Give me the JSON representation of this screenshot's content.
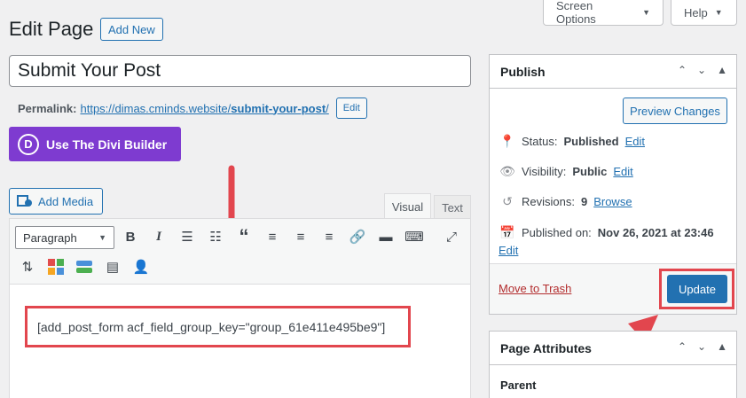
{
  "header": {
    "screen_options": "Screen Options",
    "help": "Help",
    "title": "Edit Page",
    "add_new": "Add New"
  },
  "post": {
    "title_value": "Submit Your Post",
    "permalink_label": "Permalink:",
    "permalink_base": "https://dimas.cminds.website/",
    "permalink_slug": "submit-your-post",
    "permalink_end": "/",
    "permalink_edit": "Edit"
  },
  "divi": {
    "label": "Use The Divi Builder",
    "logo_letter": "D"
  },
  "editor": {
    "add_media": "Add Media",
    "tab_visual": "Visual",
    "tab_text": "Text",
    "format_select": "Paragraph",
    "content": "[add_post_form acf_field_group_key=\"group_61e411e495be9\"]"
  },
  "publish": {
    "title": "Publish",
    "preview": "Preview Changes",
    "status_label": "Status:",
    "status_value": "Published",
    "visibility_label": "Visibility:",
    "visibility_value": "Public",
    "revisions_label": "Revisions:",
    "revisions_value": "9",
    "browse": "Browse",
    "published_label": "Published on:",
    "published_value": "Nov 26, 2021 at 23:46",
    "edit": "Edit",
    "trash": "Move to Trash",
    "update": "Update"
  },
  "attributes": {
    "title": "Page Attributes",
    "parent": "Parent"
  },
  "colors": {
    "accent": "#2271b1",
    "divi": "#7e3bd0",
    "highlight": "#e2464e"
  }
}
